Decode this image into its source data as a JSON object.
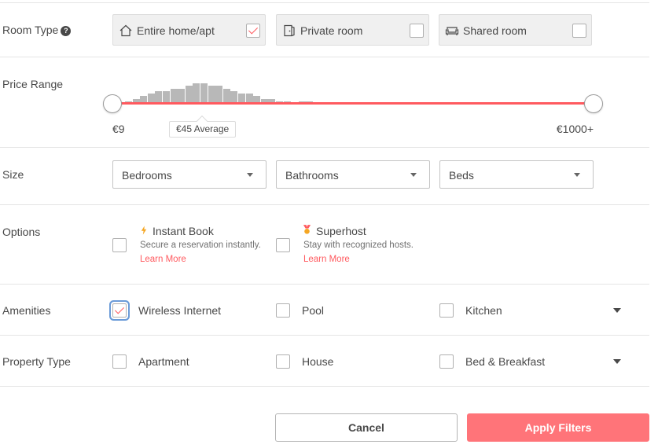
{
  "room_type": {
    "label": "Room Type",
    "help_icon": "question-circle-icon",
    "options": [
      {
        "label": "Entire home/apt",
        "icon": "house-icon",
        "checked": true
      },
      {
        "label": "Private room",
        "icon": "door-icon",
        "checked": false
      },
      {
        "label": "Shared room",
        "icon": "couch-icon",
        "checked": false
      }
    ]
  },
  "price_range": {
    "label": "Price Range",
    "min_label": "€9",
    "max_label": "€1000+",
    "average_label": "€45 Average",
    "accent_color": "#ff5a5f",
    "histogram": [
      1,
      2,
      3,
      4,
      5,
      5,
      6,
      6,
      7,
      8,
      8,
      7,
      7,
      6,
      5,
      4,
      4,
      3,
      2,
      2,
      1,
      1,
      0,
      1,
      1
    ]
  },
  "size": {
    "label": "Size",
    "selects": [
      {
        "label": "Bedrooms"
      },
      {
        "label": "Bathrooms"
      },
      {
        "label": "Beds"
      }
    ]
  },
  "options": {
    "label": "Options",
    "items": [
      {
        "title": "Instant Book",
        "icon": "lightning-icon",
        "description": "Secure a reservation instantly.",
        "link": "Learn More",
        "checked": false
      },
      {
        "title": "Superhost",
        "icon": "superhost-medal-icon",
        "description": "Stay with recognized hosts.",
        "link": "Learn More",
        "checked": false
      }
    ]
  },
  "amenities": {
    "label": "Amenities",
    "items": [
      {
        "label": "Wireless Internet",
        "checked": true
      },
      {
        "label": "Pool",
        "checked": false
      },
      {
        "label": "Kitchen",
        "checked": false
      }
    ]
  },
  "property_type": {
    "label": "Property Type",
    "items": [
      {
        "label": "Apartment",
        "checked": false
      },
      {
        "label": "House",
        "checked": false
      },
      {
        "label": "Bed & Breakfast",
        "checked": false
      }
    ]
  },
  "actions": {
    "cancel_label": "Cancel",
    "apply_label": "Apply Filters",
    "apply_color": "#ff7479"
  }
}
